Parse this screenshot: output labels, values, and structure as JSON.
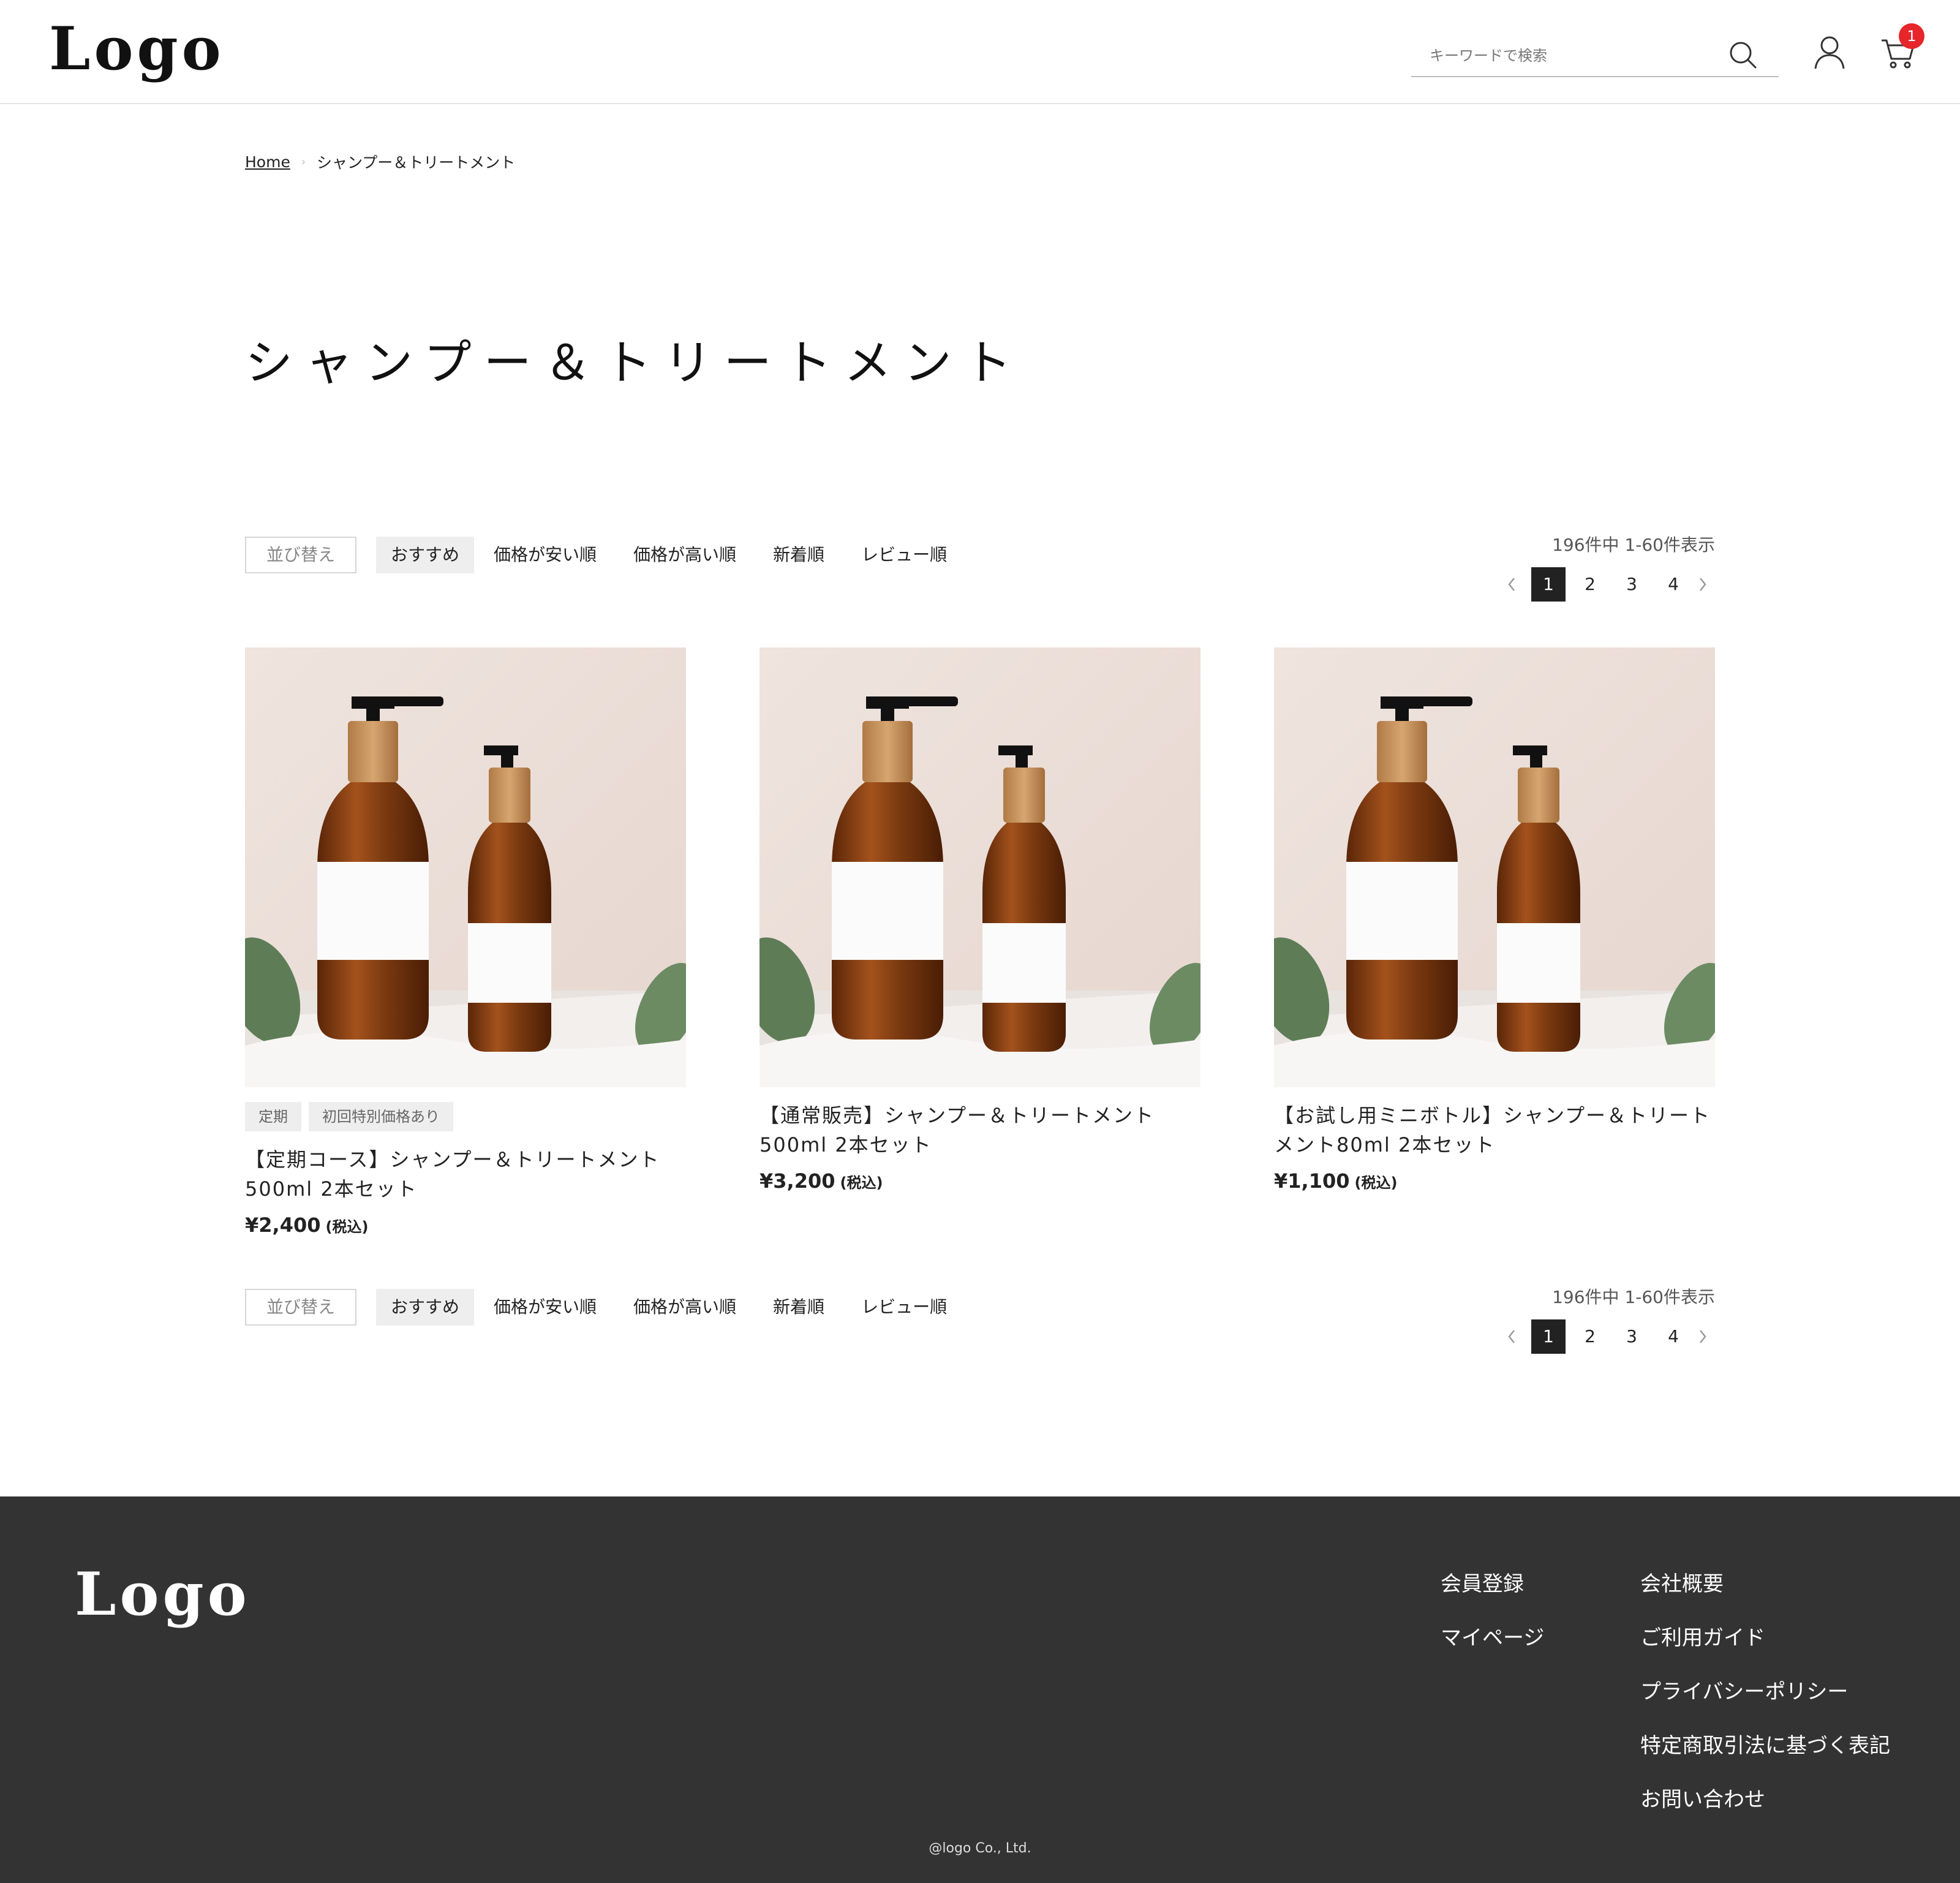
{
  "header": {
    "logo": "Logo",
    "search_placeholder": "キーワードで検索",
    "cart_count": "1"
  },
  "breadcrumb": {
    "home": "Home",
    "current": "シャンプー＆トリートメント"
  },
  "page_title": "シャンプー＆トリートメント",
  "sort": {
    "label": "並び替え",
    "options": [
      "おすすめ",
      "価格が安い順",
      "価格が高い順",
      "新着順",
      "レビュー順"
    ],
    "active": "おすすめ"
  },
  "results": {
    "count_text": "196件中  1-60件表示",
    "pages": [
      "1",
      "2",
      "3",
      "4"
    ],
    "current_page": "1"
  },
  "products": [
    {
      "tags": [
        "定期",
        "初回特別価格あり"
      ],
      "name": "【定期コース】シャンプー＆トリートメント500ml 2本セット",
      "price": "¥2,400",
      "tax": "(税込)"
    },
    {
      "tags": [],
      "name": "【通常販売】シャンプー＆トリートメント500ml 2本セット",
      "price": "¥3,200",
      "tax": "(税込)"
    },
    {
      "tags": [],
      "name": "【お試し用ミニボトル】シャンプー＆トリートメント80ml 2本セット",
      "price": "¥1,100",
      "tax": "(税込)"
    }
  ],
  "footer": {
    "logo": "Logo",
    "col1": [
      "会員登録",
      "マイページ"
    ],
    "col2": [
      "会社概要",
      "ご利用ガイド",
      "プライバシーポリシー",
      "特定商取引法に基づく表記",
      "お問い合わせ"
    ],
    "copyright": "@logo Co., Ltd."
  },
  "colors": {
    "accent_badge": "#e6262b",
    "footer_bg": "#333333",
    "active_page": "#222222"
  }
}
